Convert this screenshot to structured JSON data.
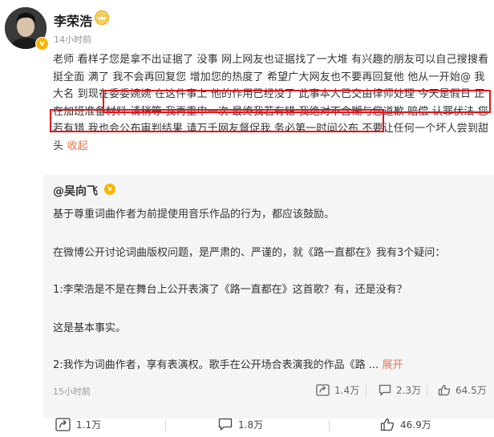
{
  "author": {
    "name": "李荣浩",
    "time": "14小时前",
    "verified_mark": "v"
  },
  "post": {
    "text_plain_1": "老师 看样子您是拿不出证据了 没事 网上网友也证据找了一大堆 有兴趣的朋友可以自己搜搜看 挺全面 满了  我不会再回复您 增加您的热度了 希望广大网友也不要再回复他",
    "text_highlight": "他从一开始@ 我大名 到现在委委婉婉 在这件事上 他的作用已经没了 此事本人已交由律师处理 今天是假日 正在加班准备材料 请稍等",
    "text_plain_2": "我再重申一次 最终我若有错 我绝对不含糊与您道歉 赔偿 认罪伏法 您若有错 我也会公布审判结果 请万千网友督促我 务必第一时间公布 不要让任何一个坏人尝到甜头",
    "collapse_label": "收起"
  },
  "repost": {
    "author": "@吴向飞",
    "verified_mark": "v",
    "lines": [
      "基于尊重词曲作者为前提使用音乐作品的行为，都应该鼓励。",
      "在微博公开讨论词曲版权问题，是严肃的、严谨的，就《路一直都在》我有3个疑问：",
      "1:李荣浩是不是在舞台上公开表演了《路一直都在》这首歌？有，还是没有？",
      "这是基本事实。",
      "2:我作为词曲作者，享有表演权。歌手在公开场合表演我的作品《路 ..."
    ],
    "expand_label": "展开",
    "time": "15小时前",
    "stats": {
      "forward": "1.4万",
      "comment": "2.3万",
      "like": "64.5万"
    }
  },
  "actions": {
    "forward": "1.1万",
    "comment": "1.8万",
    "like": "46.9万"
  }
}
